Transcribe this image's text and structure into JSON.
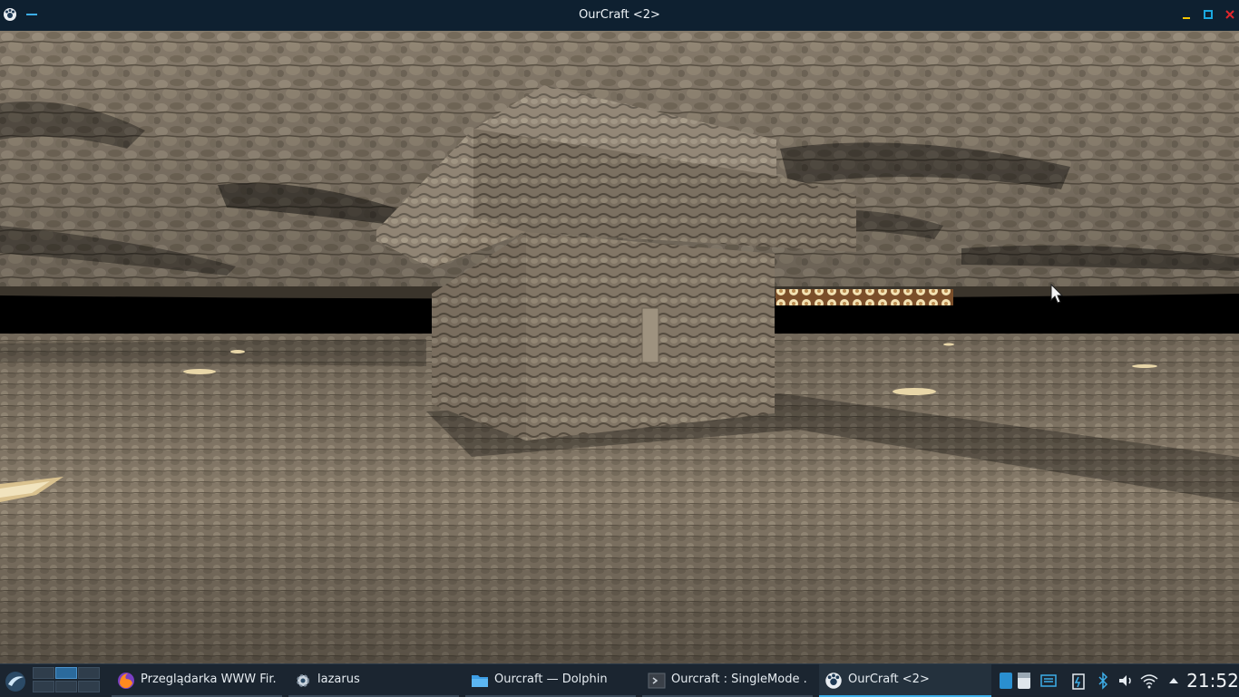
{
  "window": {
    "title": "OurCraft <2>",
    "icons": {
      "app": "ourcraft-app-icon",
      "menu": "window-menu-icon",
      "minimize": "minimize-icon",
      "maximize": "maximize-icon",
      "close": "close-icon"
    },
    "colors": {
      "titlebar_bg": "#0e2030",
      "minimize": "#f6c600",
      "maximize": "#1aa8e0",
      "close": "#e0262b"
    }
  },
  "game": {
    "scene": "cobblestone-world-view",
    "cursor": "mouse-pointer-icon"
  },
  "taskbar": {
    "launcher_icon": "application-launcher-icon",
    "pager": {
      "desktops": 6,
      "active": 2
    },
    "tasks": [
      {
        "label": "Przeglądarka WWW Fir...",
        "icon": "firefox-icon",
        "active": false
      },
      {
        "label": "lazarus",
        "icon": "lazarus-gear-icon",
        "active": false
      },
      {
        "label": "Ourcraft — Dolphin",
        "icon": "folder-icon",
        "active": false
      },
      {
        "label": "Ourcraft : SingleMode ...",
        "icon": "terminal-icon",
        "active": false
      },
      {
        "label": "OurCraft <2>",
        "icon": "ourcraft-app-icon",
        "active": true
      }
    ],
    "tray": [
      "storage-icon",
      "keyboard-layout-icon",
      "battery-icon",
      "bluetooth-icon",
      "volume-icon",
      "wifi-icon",
      "expand-tray-icon"
    ],
    "clock": "21:52",
    "colors": {
      "accent": "#3daee9",
      "background": "#1b2530"
    }
  }
}
